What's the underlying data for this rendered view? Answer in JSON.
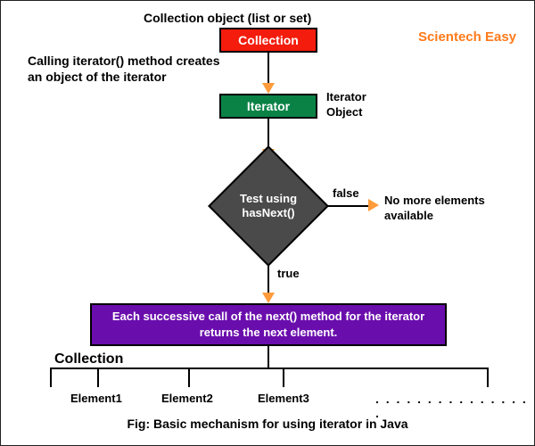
{
  "brand": "Scientech Easy",
  "header_label": "Collection object (list or set)",
  "collection_box": "Collection",
  "iterator_box": "Iterator",
  "iterator_label": "Iterator Object",
  "calling_text": "Calling iterator() method creates an object of the iterator",
  "diamond_text": "Test using hasNext()",
  "branch_false": "false",
  "branch_true": "true",
  "false_result": "No more elements available",
  "next_box": "Each successive call of the next() method for the iterator returns the next element.",
  "collection_label": "Collection",
  "elements": [
    "Element1",
    "Element2",
    "Element3"
  ],
  "ellipsis": ". . . . . . . . . . . . . . . .",
  "caption": "Fig: Basic mechanism for using iterator in Java",
  "colors": {
    "red": "#f31c0d",
    "green": "#0a8246",
    "purple": "#6a0dad",
    "gray": "#4a4a4a",
    "brand": "#ff7a1a"
  }
}
